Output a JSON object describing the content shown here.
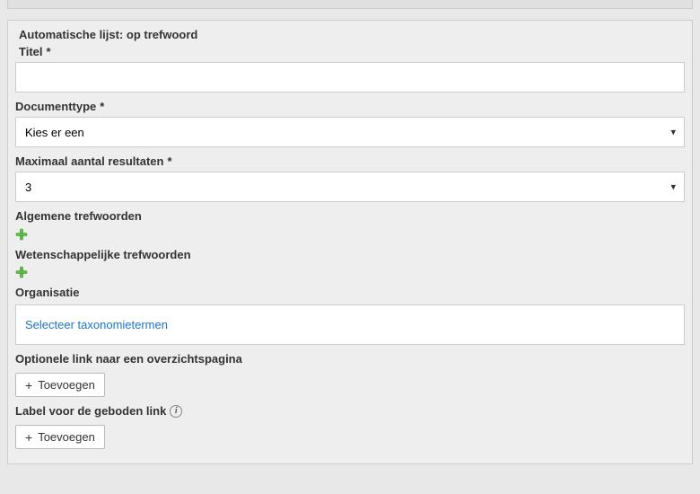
{
  "section_title": "Automatische lijst: op trefwoord",
  "fields": {
    "title": {
      "label": "Titel",
      "req": "*",
      "value": ""
    },
    "doctype": {
      "label": "Documenttype",
      "req": "*",
      "selected": "Kies er een"
    },
    "maxresults": {
      "label": "Maximaal aantal resultaten",
      "req": "*",
      "selected": "3"
    },
    "general_keywords": {
      "label": "Algemene trefwoorden"
    },
    "scientific_keywords": {
      "label": "Wetenschappelijke trefwoorden"
    },
    "organisation": {
      "label": "Organisatie",
      "select_link": "Selecteer taxonomietermen"
    },
    "optional_link": {
      "label": "Optionele link naar een overzichtspagina",
      "add_label": "Toevoegen"
    },
    "link_label": {
      "label": "Label voor de geboden link",
      "add_label": "Toevoegen"
    }
  }
}
